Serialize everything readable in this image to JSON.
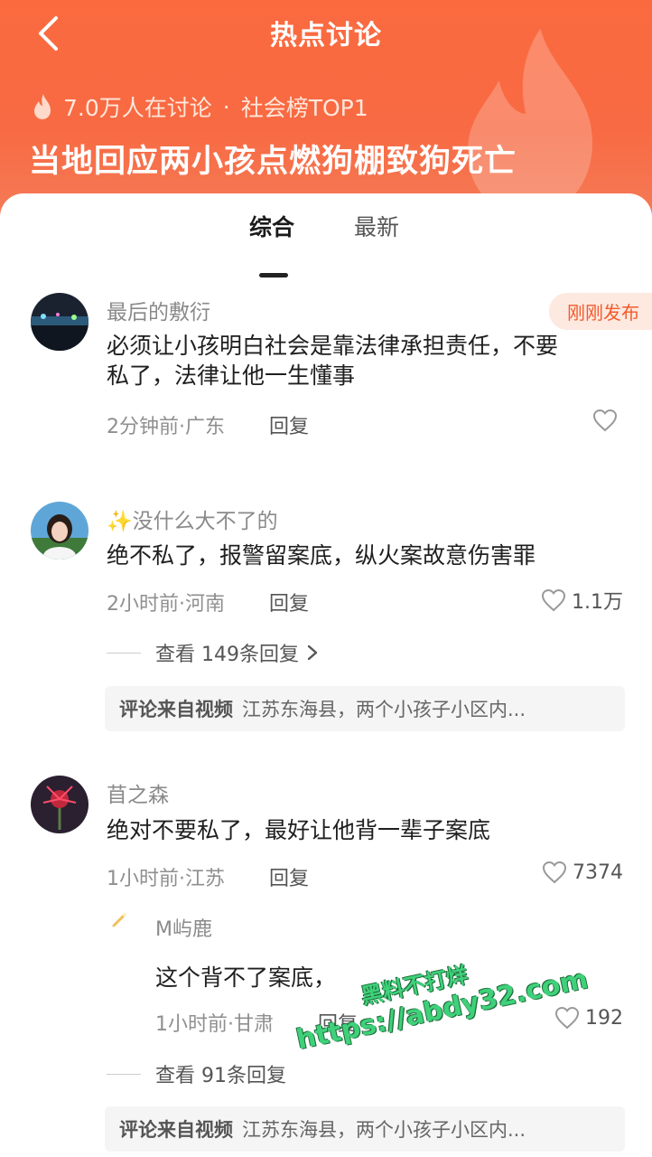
{
  "header": {
    "title": "热点讨论",
    "discussion_count": "7.0万人在讨论",
    "separator": "·",
    "rank": "社会榜TOP1",
    "topic": "当地回应两小孩点燃狗棚致狗死亡",
    "accent_color": "#f96a3f"
  },
  "tabs": [
    {
      "label": "综合",
      "active": true
    },
    {
      "label": "最新",
      "active": false
    }
  ],
  "comments": [
    {
      "username": "最后的敷衍",
      "badge": "刚刚发布",
      "content_line1": "必须让小孩明白社会是靠法律承担责任，不要",
      "content_line2": "私了，法律让他一生懂事",
      "meta": "2分钟前·广东",
      "reply_label": "回复",
      "likes": ""
    },
    {
      "username": "✨没什么大不了的",
      "content": "绝不私了，报警留案底，纵火案故意伤害罪",
      "meta": "2小时前·河南",
      "reply_label": "回复",
      "likes": "1.1万",
      "view_replies": "查看 149条回复",
      "source_label": "评论来自视频",
      "source_text": "江苏东海县，两个小孩子小区内..."
    },
    {
      "username": "苜之森",
      "content": "绝对不要私了，最好让他背一辈子案底",
      "meta": "1小时前·江苏",
      "reply_label": "回复",
      "likes": "7374",
      "sub_reply": {
        "username": "M屿鹿",
        "content": "这个背不了案底，",
        "meta": "1小时前·甘肃",
        "reply_label": "回复",
        "likes": "192"
      },
      "view_replies": "查看 91条回复",
      "source_label": "评论来自视频",
      "source_text": "江苏东海县，两个小孩子小区内..."
    }
  ],
  "watermark": {
    "line1": "黑料不打烊",
    "line2": "https://abdy32.com"
  }
}
